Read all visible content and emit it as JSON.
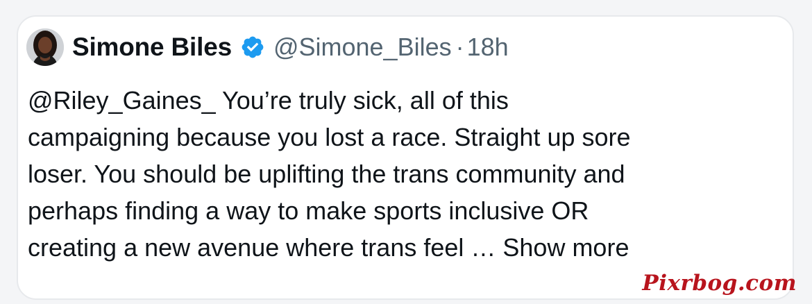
{
  "tweet": {
    "author_name": "Simone Biles",
    "handle": "@Simone_Biles",
    "separator": "·",
    "time": "18h",
    "verified_icon": "verified-badge-icon",
    "lines": [
      "@Riley_Gaines_ You’re truly sick, all of this",
      "campaigning because you lost a race. Straight up sore",
      "loser. You should be uplifting the trans community and",
      "perhaps finding a way to make sports inclusive OR"
    ],
    "last_line": "creating a new avenue where trans feel … ",
    "show_more": "Show more"
  },
  "watermark": "Pixrbog.com",
  "colors": {
    "text": "#0f1419",
    "muted": "#536471",
    "verified": "#1d9bf0",
    "watermark": "#b8141d"
  }
}
